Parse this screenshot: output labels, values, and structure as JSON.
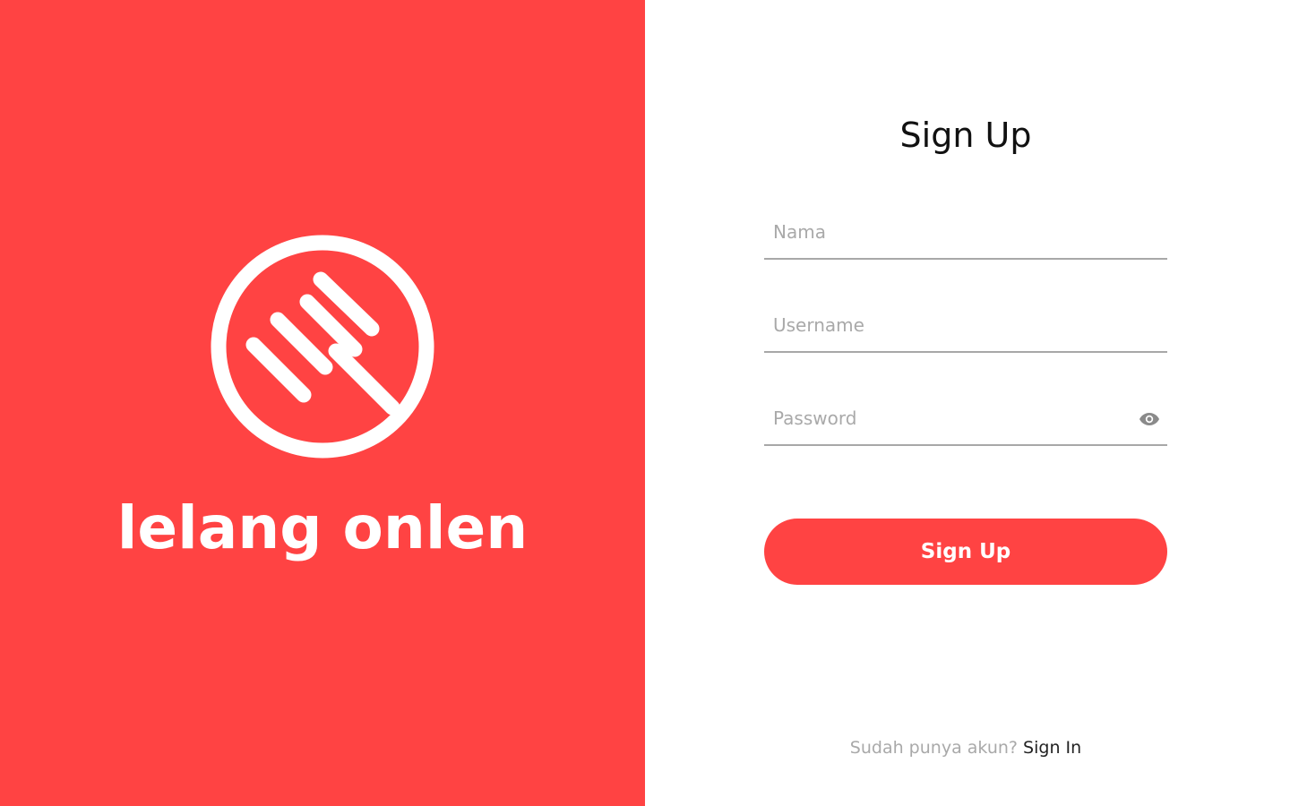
{
  "brand": {
    "name": "lelang onlen",
    "logo_icon": "gavel-circle-icon",
    "background_color": "#FF4343"
  },
  "form": {
    "title": "Sign Up",
    "fields": {
      "nama": {
        "placeholder": "Nama",
        "value": ""
      },
      "username": {
        "placeholder": "Username",
        "value": ""
      },
      "password": {
        "placeholder": "Password",
        "value": "",
        "toggle_icon": "eye-icon"
      }
    },
    "submit_label": "Sign Up",
    "accent_color": "#FF4343"
  },
  "footer": {
    "prompt": "Sudah punya akun?",
    "link_label": "Sign In"
  }
}
